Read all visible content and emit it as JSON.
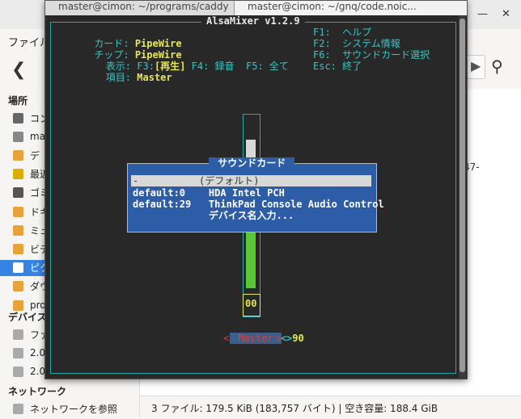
{
  "file_manager": {
    "menu_label": "ファイル",
    "sidebar": {
      "places_header": "場所",
      "places": [
        {
          "label": "コン",
          "icon": "computer-icon",
          "color": "#666666"
        },
        {
          "label": "ma",
          "icon": "home-icon",
          "color": "#888888"
        },
        {
          "label": "デ",
          "icon": "folder-icon",
          "color": "#e8a23a"
        },
        {
          "label": "最近",
          "icon": "clock-icon",
          "color": "#d8b000"
        },
        {
          "label": "ゴミ",
          "icon": "trash-icon",
          "color": "#555555"
        },
        {
          "label": "ドキ",
          "icon": "folder-icon",
          "color": "#e8a23a"
        },
        {
          "label": "ミュ",
          "icon": "music-folder-icon",
          "color": "#e8a23a"
        },
        {
          "label": "ビデ",
          "icon": "video-folder-icon",
          "color": "#e8a23a"
        },
        {
          "label": "ピク",
          "icon": "pictures-folder-icon",
          "color": "#ffffff",
          "selected": true
        },
        {
          "label": "ダウ",
          "icon": "download-folder-icon",
          "color": "#e8a23a"
        },
        {
          "label": "pro",
          "icon": "folder-icon",
          "color": "#e8a23a"
        }
      ],
      "devices_header": "デバイス",
      "devices": [
        {
          "label": "ファ",
          "icon": "drive-icon",
          "color": "#aaaaaa"
        },
        {
          "label": "2.0",
          "icon": "drive-icon",
          "color": "#aaaaaa"
        },
        {
          "label": "2.0",
          "icon": "drive-icon",
          "color": "#aaaaaa"
        }
      ],
      "network_header": "ネットワーク",
      "network": [
        {
          "label": "ネットワークを参照",
          "icon": "network-icon",
          "color": "#aaaaaa"
        }
      ]
    },
    "main_fragments": [
      ".",
      "47-"
    ],
    "status_text": "3 ファイル: 179.5 KiB (183,757 バイト)  |  空き容量: 188.4 GiB"
  },
  "terminal": {
    "tabs": [
      {
        "label": "master@cimon: ~/programs/caddy"
      },
      {
        "label": "master@cimon: ~/gnq/code.noic..."
      }
    ],
    "alsamixer": {
      "title": "AlsaMixer v1.2.9",
      "card_label": "カード: ",
      "card_value": "PipeWire",
      "chip_label": "チップ: ",
      "chip_value": "PipeWire",
      "view_label": "  表示: F3:",
      "view_current": "[再生]",
      "view_rest": " F4: 録音  F5: 全て",
      "item_label": "  項目: ",
      "item_value": "Master",
      "keys": [
        "F1:  ヘルプ",
        "F2:  システム情報",
        "F6:  サウンドカード選択",
        "Esc: 終了"
      ],
      "mute_text": "00",
      "level_left": "90",
      "level_sep": "<>",
      "level_right": "90",
      "level_percent": 90,
      "channel_name": "Master",
      "dialog": {
        "title": " サウンドカード ",
        "selected_marker": "-",
        "selected_item": "(デフォルト)",
        "rows": [
          "default:0    HDA Intel PCH",
          "default:29   ThinkPad Console Audio Control",
          "             デバイス名入力..."
        ]
      }
    }
  }
}
